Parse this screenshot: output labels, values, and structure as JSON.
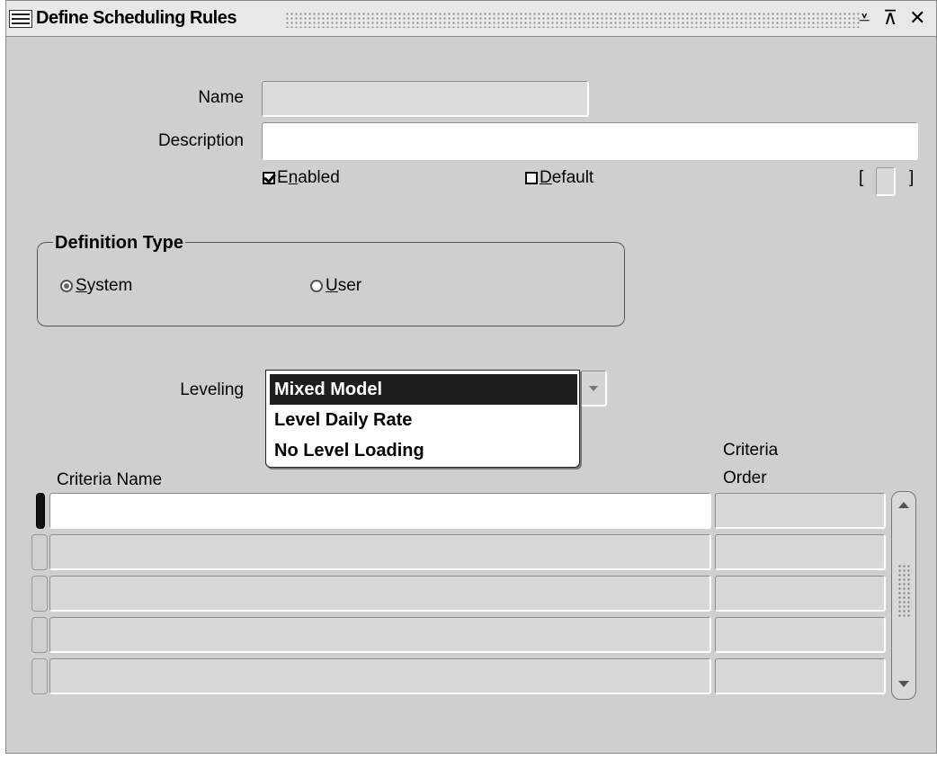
{
  "window": {
    "title": "Define Scheduling Rules",
    "controls": {
      "minimize": "⩡",
      "maximize": "⊼",
      "close": "✕"
    }
  },
  "form": {
    "name_label": "Name",
    "name_value": "",
    "description_label": "Description",
    "description_value": "",
    "enabled": {
      "pre": "E",
      "accel": "n",
      "post": "abled",
      "checked": true
    },
    "default": {
      "accel": "D",
      "post": "efault",
      "checked": false
    },
    "bracket_open": "[",
    "bracket_close": "]"
  },
  "definition_type": {
    "title": "Definition Type",
    "system": {
      "accel": "S",
      "post": "ystem",
      "selected": true
    },
    "user": {
      "accel": "U",
      "post": "ser",
      "selected": false
    }
  },
  "leveling": {
    "label": "Leveling",
    "options": [
      "Mixed Model",
      "Level Daily Rate",
      "No Level Loading"
    ],
    "selected": "Mixed Model"
  },
  "criteria_table": {
    "columns": {
      "criteria_name": "Criteria Name",
      "criteria_order_line1": "Criteria",
      "criteria_order_line2": "Order"
    },
    "rows": [
      {
        "name": "",
        "order": ""
      },
      {
        "name": "",
        "order": ""
      },
      {
        "name": "",
        "order": ""
      },
      {
        "name": "",
        "order": ""
      },
      {
        "name": "",
        "order": ""
      }
    ]
  },
  "colors": {
    "window_bg": "#cfcfcf",
    "selected_option_bg": "#1e1e1e",
    "selected_option_text": "#ffffff"
  }
}
